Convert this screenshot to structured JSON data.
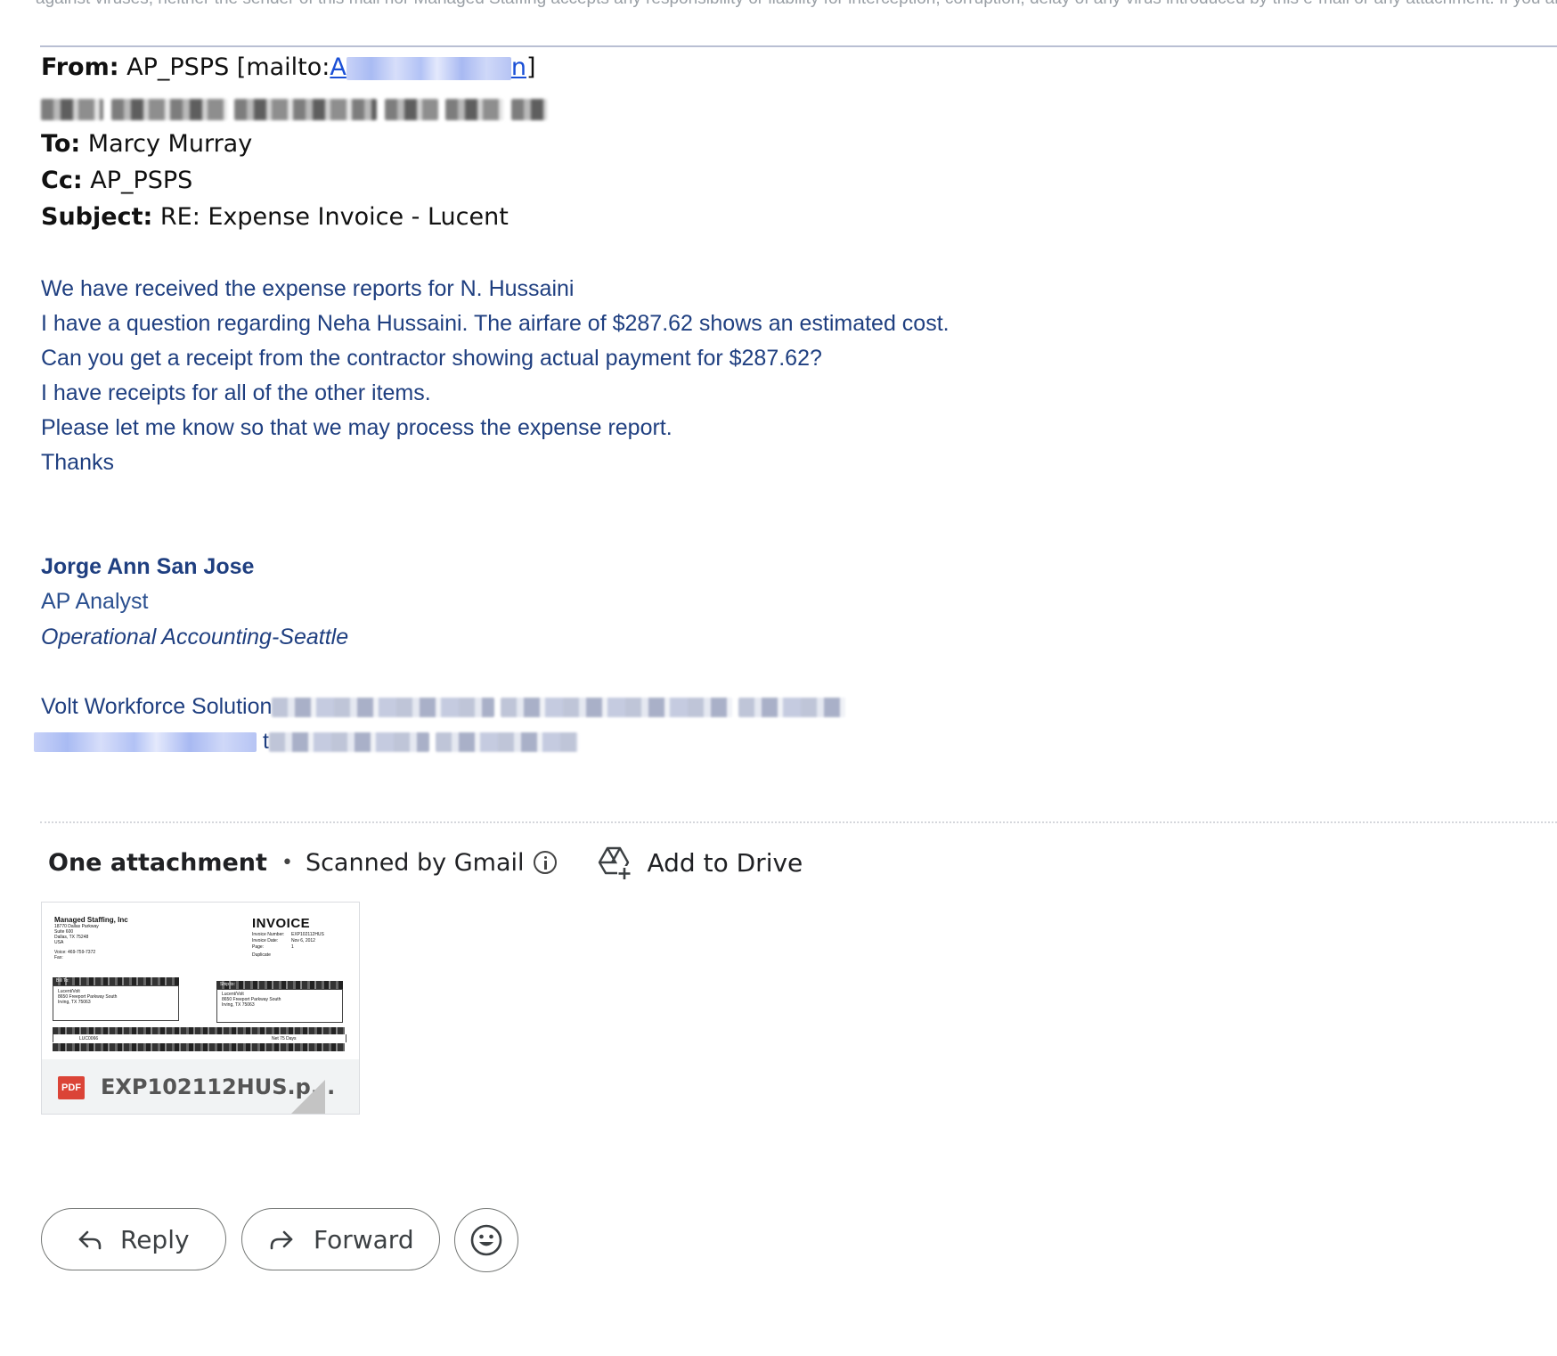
{
  "top_cut_text": "against viruses, neither the sender of this mail nor Managed Staffing accepts any responsibility or liability for interception, corruption, delay of any virus introduced by this e-mail or any attachment. If you are",
  "header": {
    "from_label": "From:",
    "from_value": "AP_PSPS [mailto:",
    "from_link_start": "A",
    "from_link_end": "n",
    "from_close": "]",
    "to_label": "To:",
    "to_value": "Marcy Murray",
    "cc_label": "Cc:",
    "cc_value": "AP_PSPS",
    "subject_label": "Subject:",
    "subject_value": "RE: Expense Invoice - Lucent"
  },
  "body": {
    "lines": [
      "We have received the expense reports for N. Hussaini",
      "I have a question regarding Neha Hussaini.  The airfare of $287.62 shows an estimated cost.",
      "Can you get a receipt from the contractor showing actual payment for $287.62?",
      "I have receipts for all of the other items.",
      "Please let me know so that we may process the expense report.",
      "Thanks"
    ]
  },
  "signature": {
    "name": "Jorge Ann San Jose",
    "role": "AP Analyst",
    "dept": "Operational Accounting-Seattle",
    "company": "Volt Workforce Solution",
    "contact_sep": "t"
  },
  "attachment": {
    "title": "One attachment",
    "dot": "•",
    "scanned": "Scanned by Gmail",
    "add_to_drive": "Add to Drive",
    "filename": "EXP102112HUS.p...",
    "file_type": "PDF",
    "thumb": {
      "company": "Managed Staffing, Inc",
      "addr1": "18770 Dallas Parkway",
      "addr2": "Suite 600",
      "addr3": "Dallas, TX 75248",
      "addr4": "USA",
      "voice": "Voice:   469-759-7372",
      "fax": "Fax:",
      "heading": "INVOICE",
      "inv_num_label": "Invoice Number:",
      "inv_num": "EXP102112HUS",
      "inv_date_label": "Invoice Date:",
      "inv_date": "Nov 6, 2012",
      "page_label": "Page:",
      "page": "1",
      "duplicate": "Duplicate",
      "bill_to": "Bill To:",
      "ship_to": "Ship to:",
      "bill_name": "Lucent/Volt",
      "bill_addr": "8650 Freeport Parkway South",
      "bill_city": "Irving, TX 75063",
      "ship_name": "Lucent/Volt",
      "ship_addr": "8650 Freeport Parkway South",
      "ship_city": "Irving, TX 75063",
      "cust_id": "LUC0066",
      "terms": "Net 75 Days"
    }
  },
  "actions": {
    "reply": "Reply",
    "forward": "Forward"
  },
  "icons": {
    "info": "info-icon",
    "drive": "add-to-drive-icon",
    "reply": "reply-icon",
    "forward": "forward-icon",
    "emoji": "emoji-icon"
  }
}
